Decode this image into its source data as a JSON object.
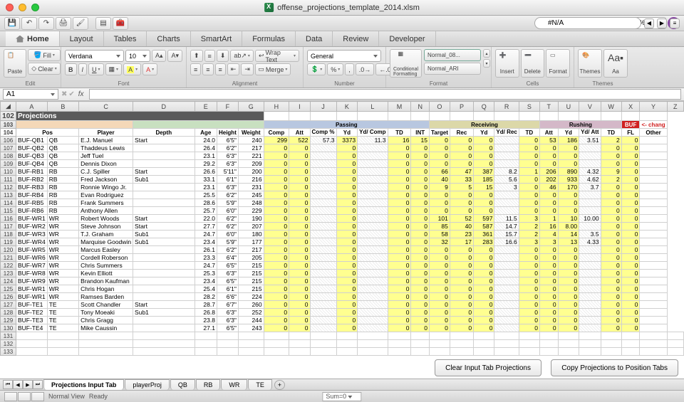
{
  "window": {
    "title": "offense_projections_template_2014.xlsm"
  },
  "qat": {
    "zoom": "105%",
    "search": "#N/A"
  },
  "tabs": [
    "Home",
    "Layout",
    "Tables",
    "Charts",
    "SmartArt",
    "Formulas",
    "Data",
    "Review",
    "Developer"
  ],
  "activeTab": 0,
  "ribbon": {
    "edit_fill": "Fill",
    "edit_clear": "Clear",
    "paste": "Paste",
    "font_name": "Verdana",
    "font_size": "10",
    "wrap": "Wrap Text",
    "merge": "Merge",
    "numfmt": "General",
    "condfmt": "Conditional Formatting",
    "style1": "Normal_08...",
    "style2": "Normal_ARI",
    "insert": "Insert",
    "delete": "Delete",
    "format": "Format",
    "themes": "Themes",
    "aa": "Aa"
  },
  "namebox": "A1",
  "colLetters": [
    "A",
    "B",
    "C",
    "D",
    "E",
    "F",
    "G",
    "H",
    "I",
    "J",
    "K",
    "L",
    "M",
    "N",
    "O",
    "P",
    "Q",
    "R",
    "S",
    "T",
    "U",
    "V",
    "W",
    "X",
    "Y",
    "Z"
  ],
  "projTitle": "Projections",
  "bufTag": "BUF",
  "chgNote": "<- chang",
  "groups": {
    "pass": "Passing",
    "recv": "Receiving",
    "rush": "Rushing",
    "other": "Other"
  },
  "cols": {
    "pos": "Pos",
    "player": "Player",
    "depth": "Depth",
    "age": "Age",
    "height": "Height",
    "weight": "Weight",
    "comp": "Comp",
    "att": "Att",
    "comppct": "Comp %",
    "yd": "Yd",
    "ydcomp": "Yd/ Comp",
    "td": "TD",
    "int": "INT",
    "target": "Target",
    "rec": "Rec",
    "ryd": "Yd",
    "ydrec": "Yd/ Rec",
    "rtd": "TD",
    "ratt": "Att",
    "ruyd": "Yd",
    "ydatt": "Yd/ Att",
    "rutd": "TD",
    "fl": "FL"
  },
  "chart_data": {
    "type": "table",
    "rows": [
      {
        "rn": 106,
        "id": "BUF-QB1",
        "pos": "QB",
        "player": "E.J. Manuel",
        "depth": "Start",
        "age": "24.0",
        "ht": "6'5\"",
        "wt": 240,
        "stats": [
          299,
          522,
          57.3,
          3373,
          11.3,
          16,
          15,
          0,
          0,
          0,
          "",
          0,
          53,
          186,
          3.51,
          2,
          0
        ]
      },
      {
        "rn": 107,
        "id": "BUF-QB2",
        "pos": "QB",
        "player": "Thaddeus Lewis",
        "depth": "",
        "age": "26.4",
        "ht": "6'2\"",
        "wt": 217,
        "stats": [
          0,
          0,
          "",
          0,
          "",
          0,
          0,
          0,
          0,
          0,
          "",
          0,
          0,
          0,
          "",
          0,
          0
        ]
      },
      {
        "rn": 108,
        "id": "BUF-QB3",
        "pos": "QB",
        "player": "Jeff Tuel",
        "depth": "",
        "age": "23.1",
        "ht": "6'3\"",
        "wt": 221,
        "stats": [
          0,
          0,
          "",
          0,
          "",
          0,
          0,
          0,
          0,
          0,
          "",
          0,
          0,
          0,
          "",
          0,
          0
        ]
      },
      {
        "rn": 109,
        "id": "BUF-QB4",
        "pos": "QB",
        "player": "Dennis Dixon",
        "depth": "",
        "age": "29.2",
        "ht": "6'3\"",
        "wt": 209,
        "stats": [
          0,
          0,
          "",
          0,
          "",
          0,
          0,
          0,
          0,
          0,
          "",
          0,
          0,
          0,
          "",
          0,
          0
        ]
      },
      {
        "rn": 110,
        "id": "BUF-RB1",
        "pos": "RB",
        "player": "C.J. Spiller",
        "depth": "Start",
        "age": "26.6",
        "ht": "5'11\"",
        "wt": 200,
        "stats": [
          0,
          0,
          "",
          0,
          "",
          0,
          0,
          66,
          47,
          387,
          8.2,
          1,
          206,
          890,
          4.32,
          9,
          0
        ]
      },
      {
        "rn": 111,
        "id": "BUF-RB2",
        "pos": "RB",
        "player": "Fred Jackson",
        "depth": "Sub1",
        "age": "33.1",
        "ht": "6'1\"",
        "wt": 216,
        "stats": [
          0,
          0,
          "",
          0,
          "",
          0,
          0,
          40,
          33,
          185,
          5.6,
          0,
          202,
          933,
          4.62,
          2,
          0
        ]
      },
      {
        "rn": 112,
        "id": "BUF-RB3",
        "pos": "RB",
        "player": "Ronnie Wingo Jr.",
        "depth": "",
        "age": "23.1",
        "ht": "6'3\"",
        "wt": 231,
        "stats": [
          0,
          0,
          "",
          0,
          "",
          0,
          0,
          9,
          5,
          15,
          3.0,
          0,
          46,
          170,
          3.7,
          0,
          0
        ]
      },
      {
        "rn": 113,
        "id": "BUF-RB4",
        "pos": "RB",
        "player": "Evan Rodriguez",
        "depth": "",
        "age": "25.5",
        "ht": "6'2\"",
        "wt": 245,
        "stats": [
          0,
          0,
          "",
          0,
          "",
          0,
          0,
          0,
          0,
          0,
          "",
          0,
          0,
          0,
          "",
          0,
          0
        ]
      },
      {
        "rn": 114,
        "id": "BUF-RB5",
        "pos": "RB",
        "player": "Frank Summers",
        "depth": "",
        "age": "28.6",
        "ht": "5'9\"",
        "wt": 248,
        "stats": [
          0,
          0,
          "",
          0,
          "",
          0,
          0,
          0,
          0,
          0,
          "",
          0,
          0,
          0,
          "",
          0,
          0
        ]
      },
      {
        "rn": 115,
        "id": "BUF-RB6",
        "pos": "RB",
        "player": "Anthony Allen",
        "depth": "",
        "age": "25.7",
        "ht": "6'0\"",
        "wt": 229,
        "stats": [
          0,
          0,
          "",
          0,
          "",
          0,
          0,
          0,
          0,
          0,
          "",
          0,
          0,
          0,
          "",
          0,
          0
        ]
      },
      {
        "rn": 116,
        "id": "BUF-WR1",
        "pos": "WR",
        "player": "Robert Woods",
        "depth": "Start",
        "age": "22.0",
        "ht": "6'2\"",
        "wt": 190,
        "stats": [
          0,
          0,
          "",
          0,
          "",
          0,
          0,
          101,
          52,
          597,
          11.5,
          3,
          1,
          10,
          "10.00",
          0,
          0
        ]
      },
      {
        "rn": 117,
        "id": "BUF-WR2",
        "pos": "WR",
        "player": "Steve Johnson",
        "depth": "Start",
        "age": "27.7",
        "ht": "6'2\"",
        "wt": 207,
        "stats": [
          0,
          0,
          "",
          0,
          "",
          0,
          0,
          85,
          40,
          587,
          14.7,
          2,
          16,
          "8.00",
          "",
          0,
          0
        ]
      },
      {
        "rn": 118,
        "id": "BUF-WR3",
        "pos": "WR",
        "player": "T.J. Graham",
        "depth": "Sub1",
        "age": "24.7",
        "ht": "6'0\"",
        "wt": 180,
        "stats": [
          0,
          0,
          "",
          0,
          "",
          0,
          0,
          58,
          23,
          361,
          15.7,
          2,
          4,
          14,
          3.5,
          0,
          0
        ]
      },
      {
        "rn": 119,
        "id": "BUF-WR4",
        "pos": "WR",
        "player": "Marquise Goodwin",
        "depth": "Sub1",
        "age": "23.4",
        "ht": "5'9\"",
        "wt": 177,
        "stats": [
          0,
          0,
          "",
          0,
          "",
          0,
          0,
          32,
          17,
          283,
          16.6,
          3,
          3,
          13,
          4.33,
          0,
          0
        ]
      },
      {
        "rn": 120,
        "id": "BUF-WR5",
        "pos": "WR",
        "player": "Marcus Easley",
        "depth": "",
        "age": "26.1",
        "ht": "6'2\"",
        "wt": 217,
        "stats": [
          0,
          0,
          "",
          0,
          "",
          0,
          0,
          0,
          0,
          0,
          "",
          0,
          0,
          0,
          "",
          0,
          0
        ]
      },
      {
        "rn": 121,
        "id": "BUF-WR6",
        "pos": "WR",
        "player": "Cordell Roberson",
        "depth": "",
        "age": "23.3",
        "ht": "6'4\"",
        "wt": 205,
        "stats": [
          0,
          0,
          "",
          0,
          "",
          0,
          0,
          0,
          0,
          0,
          "",
          0,
          0,
          0,
          "",
          0,
          0
        ]
      },
      {
        "rn": 122,
        "id": "BUF-WR7",
        "pos": "WR",
        "player": "Chris Summers",
        "depth": "",
        "age": "24.7",
        "ht": "6'5\"",
        "wt": 215,
        "stats": [
          0,
          0,
          "",
          0,
          "",
          0,
          0,
          0,
          0,
          0,
          "",
          0,
          0,
          0,
          "",
          0,
          0
        ]
      },
      {
        "rn": 123,
        "id": "BUF-WR8",
        "pos": "WR",
        "player": "Kevin Elliott",
        "depth": "",
        "age": "25.3",
        "ht": "6'3\"",
        "wt": 215,
        "stats": [
          0,
          0,
          "",
          0,
          "",
          0,
          0,
          0,
          0,
          0,
          "",
          0,
          0,
          0,
          "",
          0,
          0
        ]
      },
      {
        "rn": 124,
        "id": "BUF-WR9",
        "pos": "WR",
        "player": "Brandon Kaufman",
        "depth": "",
        "age": "23.4",
        "ht": "6'5\"",
        "wt": 215,
        "stats": [
          0,
          0,
          "",
          0,
          "",
          0,
          0,
          0,
          0,
          0,
          "",
          0,
          0,
          0,
          "",
          0,
          0
        ]
      },
      {
        "rn": 125,
        "id": "BUF-WR1",
        "pos": "WR",
        "player": "Chris Hogan",
        "depth": "",
        "age": "25.4",
        "ht": "6'1\"",
        "wt": 215,
        "stats": [
          0,
          0,
          "",
          0,
          "",
          0,
          0,
          0,
          0,
          0,
          "",
          0,
          0,
          0,
          "",
          0,
          0
        ]
      },
      {
        "rn": 126,
        "id": "BUF-WR1",
        "pos": "WR",
        "player": "Ramses Barden",
        "depth": "",
        "age": "28.2",
        "ht": "6'6\"",
        "wt": 224,
        "stats": [
          0,
          0,
          "",
          0,
          "",
          0,
          0,
          0,
          0,
          0,
          "",
          0,
          0,
          0,
          "",
          0,
          0
        ]
      },
      {
        "rn": 127,
        "id": "BUF-TE1",
        "pos": "TE",
        "player": "Scott Chandler",
        "depth": "Start",
        "age": "28.7",
        "ht": "6'7\"",
        "wt": 260,
        "stats": [
          0,
          0,
          "",
          0,
          "",
          0,
          0,
          0,
          0,
          0,
          "",
          0,
          0,
          0,
          "",
          0,
          0
        ]
      },
      {
        "rn": 128,
        "id": "BUF-TE2",
        "pos": "TE",
        "player": "Tony Moeaki",
        "depth": "Sub1",
        "age": "26.8",
        "ht": "6'3\"",
        "wt": 252,
        "stats": [
          0,
          0,
          "",
          0,
          "",
          0,
          0,
          0,
          0,
          0,
          "",
          0,
          0,
          0,
          "",
          0,
          0
        ]
      },
      {
        "rn": 129,
        "id": "BUF-TE3",
        "pos": "TE",
        "player": "Chris Gragg",
        "depth": "",
        "age": "23.8",
        "ht": "6'3\"",
        "wt": 244,
        "stats": [
          0,
          0,
          "",
          0,
          "",
          0,
          0,
          0,
          0,
          0,
          "",
          0,
          0,
          0,
          "",
          0,
          0
        ]
      },
      {
        "rn": 130,
        "id": "BUF-TE4",
        "pos": "TE",
        "player": "Mike Caussin",
        "depth": "",
        "age": "27.1",
        "ht": "6'5\"",
        "wt": 243,
        "stats": [
          0,
          0,
          "",
          0,
          "",
          0,
          0,
          0,
          0,
          0,
          "",
          0,
          0,
          0,
          "",
          0,
          0
        ]
      }
    ]
  },
  "btns": {
    "clear": "Clear Input Tab Projections",
    "copy": "Copy Projections to Position Tabs"
  },
  "wsTabs": [
    "Projections Input Tab",
    "playerProj",
    "QB",
    "RB",
    "WR",
    "TE"
  ],
  "wsActive": 0,
  "status": {
    "view": "Normal View",
    "ready": "Ready",
    "sum": "Sum=0"
  }
}
